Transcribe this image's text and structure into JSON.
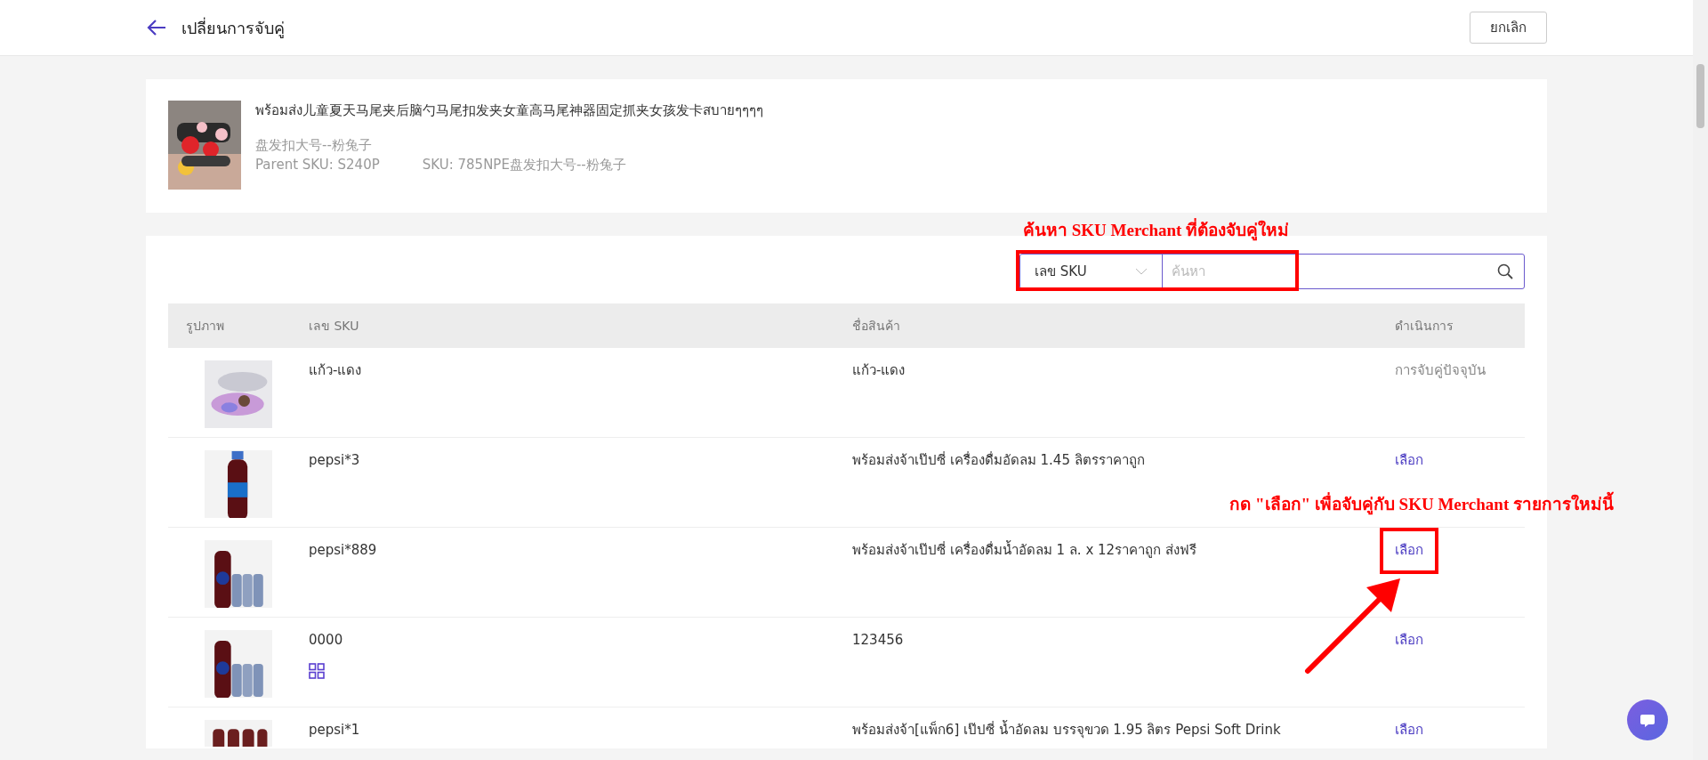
{
  "header": {
    "title": "เปลี่ยนการจับคู่",
    "cancel_button": "ยกเลิก"
  },
  "product": {
    "name": "พร้อมส่ง儿童夏天马尾夹后脑勺马尾扣发夹女童高马尾神器固定抓夹女孩发卡สบายๆๆๆๆ",
    "variant": "盘发扣大号--粉兔子",
    "parent_sku": "Parent SKU: S240P",
    "sku": "SKU: 785NPE盘发扣大号--粉兔子"
  },
  "search": {
    "type_select": "เลข SKU",
    "placeholder": "ค้นหา"
  },
  "table": {
    "columns": [
      "รูปภาพ",
      "เลข SKU",
      "ชื่อสินค้า",
      "ดำเนินการ"
    ],
    "rows": [
      {
        "sku": "แก้ว-แดง",
        "combo": false,
        "name": "แก้ว-แดง",
        "action": {
          "kind": "current",
          "text": "การจับคู่ปัจจุบัน"
        }
      },
      {
        "sku": "pepsi*3",
        "combo": false,
        "name": "พร้อมส่งจ้าเป๊ปซี่ เครื่องดื่มอัดลม 1.45 ลิตรราคาถูก",
        "action": {
          "kind": "link",
          "text": "เลือก"
        }
      },
      {
        "sku": "pepsi*889",
        "combo": false,
        "name": "พร้อมส่งจ้าเป๊ปซี่ เครื่องดื่มน้ำอัดลม 1 ล. x 12ราคาถูก ส่งฟรี",
        "action": {
          "kind": "link",
          "text": "เลือก"
        }
      },
      {
        "sku": "0000",
        "combo": true,
        "name": "123456",
        "action": {
          "kind": "link",
          "text": "เลือก"
        }
      },
      {
        "sku": "pepsi*1",
        "combo": false,
        "name": "พร้อมส่งจ้า[แพ็ก6] เป๊ปซี่ น้ำอัดลม บรรจุขวด 1.95 ลิตร Pepsi Soft Drink",
        "action": {
          "kind": "link",
          "text": "เลือก"
        }
      }
    ]
  },
  "annotations": {
    "search_note": "ค้นหา SKU Merchant ที่ต้องจับคู่ใหม่",
    "select_note": "กด \"เลือก\" เพื่อจับคู่กับ SKU Merchant รายการใหม่นี้"
  }
}
